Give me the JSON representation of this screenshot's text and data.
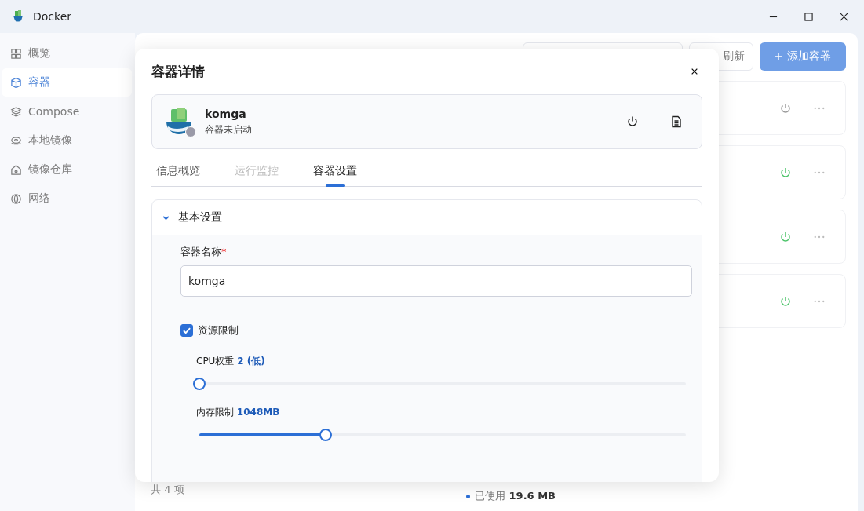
{
  "window": {
    "title": "Docker"
  },
  "sidebar": {
    "items": [
      {
        "label": "概览",
        "selected": false
      },
      {
        "label": "容器",
        "selected": true
      },
      {
        "label": "Compose",
        "selected": false
      },
      {
        "label": "本地镜像",
        "selected": false
      },
      {
        "label": "镜像仓库",
        "selected": false
      },
      {
        "label": "网络",
        "selected": false
      }
    ]
  },
  "toolbar": {
    "refresh_button": "刷新",
    "add_button": "添加容器"
  },
  "container_cards": [
    {
      "running": false
    },
    {
      "running": true
    },
    {
      "running": true
    },
    {
      "running": true
    }
  ],
  "footer": {
    "count": "共 4 项",
    "usage_label": "已使用",
    "usage_value": "19.6 MB"
  },
  "dialog": {
    "title": "容器详情",
    "container": {
      "name": "komga",
      "status": "容器未启动",
      "running": false
    },
    "tabs": [
      {
        "label": "信息概览",
        "selected": false,
        "disabled": false
      },
      {
        "label": "运行监控",
        "selected": false,
        "disabled": true
      },
      {
        "label": "容器设置",
        "selected": true,
        "disabled": false
      }
    ],
    "section": {
      "title": "基本设置",
      "expanded": true
    },
    "name_field": {
      "label": "容器名称",
      "required_mark": "*",
      "value": "komga"
    },
    "resource_limit": {
      "label": "资源限制",
      "checked": true
    },
    "sliders": [
      {
        "label": "CPU权重",
        "reading": "2 (低)",
        "level": 0
      },
      {
        "label": "内存限制",
        "reading": "1048MB",
        "level": 0.26
      }
    ]
  }
}
